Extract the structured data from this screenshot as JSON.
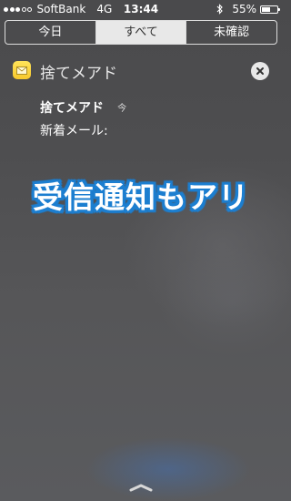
{
  "status_bar": {
    "carrier": "SoftBank",
    "network": "4G",
    "time": "13:44",
    "battery_percent": "55%",
    "battery_level": 0.55,
    "signal_bars_on": 3,
    "signal_bars_total": 5
  },
  "tabs": [
    {
      "label": "今日",
      "active": false
    },
    {
      "label": "すべて",
      "active": true
    },
    {
      "label": "未確認",
      "active": false
    }
  ],
  "section": {
    "app_name": "捨てメアド",
    "app_icon": "mail-icon"
  },
  "notification": {
    "title": "捨てメアド",
    "time": "今",
    "body": "新着メール:"
  },
  "overlay_caption": "受信通知もアリ",
  "colors": {
    "accent_outline": "#1d7fd0",
    "app_icon_yellow": "#f7c82c"
  }
}
